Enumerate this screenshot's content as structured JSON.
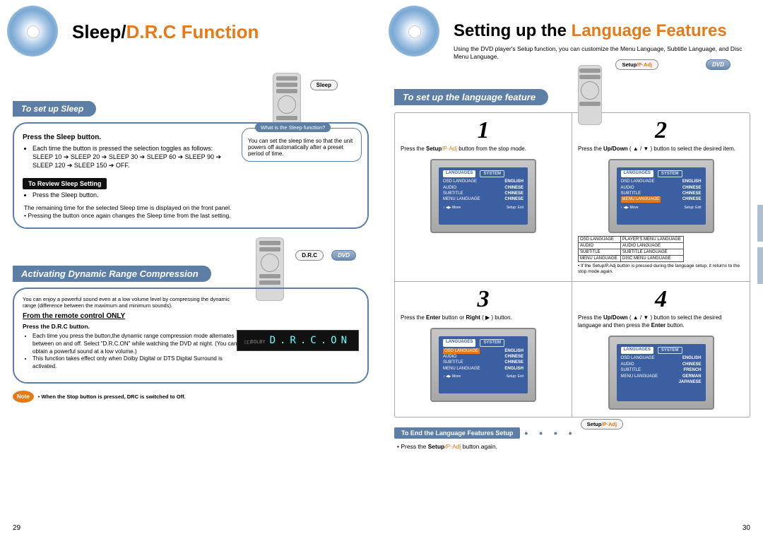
{
  "left": {
    "title_a": "Sleep/",
    "title_b": "D.R.C Function",
    "band_sleep": "To set up Sleep",
    "sleep_btn_label": "Sleep",
    "press_sleep": "Press the Sleep button.",
    "sleep_toggles1": "Each time the button is pressed the selection toggles as follows: SLEEP 10 ➔ SLEEP 20 ➔ SLEEP 30 ➔ SLEEP 60 ➔ SLEEP 90 ➔ SLEEP 120 ➔ SLEEP 150 ➔ OFF.",
    "review_bar": "To Review Sleep Setting",
    "review_1": "Press the Sleep button.",
    "review_2": "The remaining time for the selected Sleep time is displayed on the front panel.",
    "review_3": "Pressing the button once again changes the Sleep time from the last setting.",
    "callout_tab": "What is the Sleep function?",
    "callout_body": "You can set the sleep time so that the unit powers off automatically after a preset period of time.",
    "band_drc": "Activating Dynamic Range Compression",
    "drc_btn_label": "D.R.C",
    "dvd_label": "DVD",
    "drc_intro": "You can enjoy a powerful sound even at a low volume level by compressing the dynamic range (difference between the maximum and minimum sounds).",
    "drc_remote_only": "From the remote control ONLY",
    "press_drc": "Press the D.R.C button.",
    "drc_1": "Each time you press the button,the dynamic range compression mode alternates between on and off. Select \"D.R.C.ON\" while watching the DVD at night. (You can obtain a powerful sound at a low volume.)",
    "drc_2": "This function takes effect only when Dolby Digital or DTS Digital Surround is activated.",
    "lcd_text": "D.R.C.ON",
    "note_label": "Note",
    "note_text": "When the Stop button is pressed, DRC is switched to Off.",
    "page": "29"
  },
  "right": {
    "title_a": "Setting up the ",
    "title_b": "Language Features",
    "sub": "Using the DVD player's Setup function, you can customize the Menu Language, Subtitle Language, and Disc Menu Language.",
    "band": "To set up the language feature",
    "setup_btn": "Setup/P·Adj",
    "dvd_label": "DVD",
    "step1_num": "1",
    "step1": "Press the Setup/P·Adj button from the stop mode.",
    "step2_num": "2",
    "step2": "Press the Up/Down ( ▲ / ▼ )  button  to select the desired item.",
    "step2_foot": "If the Setup/P.Adj button is pressed during the language setup, it returns to the stop mode again.",
    "step3_num": "3",
    "step3": "Press the Enter button or Right ( ▶ ) button.",
    "step4_num": "4",
    "step4": "Press the Up/Down ( ▲ / ▼ ) button to select the desired language and then press the Enter button.",
    "tv_tab_lang": "LANGUAGES",
    "tv_tab_sys": "SYSTEM",
    "tv_rows": [
      {
        "k": "OSD LANGUAGE",
        "v": "ENGLISH"
      },
      {
        "k": "AUDIO",
        "v": "CHINESE"
      },
      {
        "k": "SUBTITLE",
        "v": "CHINESE"
      },
      {
        "k": "MENU LANGUAGE",
        "v": "CHINESE"
      }
    ],
    "tv3_rows": [
      {
        "k": "OSD LANGUAGE",
        "v": "ENGLISH"
      },
      {
        "k": "AUDIO",
        "v": "CHINESE"
      },
      {
        "k": "SUBTITLE",
        "v": "CHINESE"
      },
      {
        "k": "MENU LANGUAGE",
        "v": "ENGLISH"
      }
    ],
    "tv4_rows": [
      {
        "k": "OSD LANGUAGE",
        "v": "ENGLISH"
      },
      {
        "k": "AUDIO",
        "v": "CHINESE"
      },
      {
        "k": "SUBTITLE",
        "v": "FRENCH"
      },
      {
        "k": "MENU LANGUAGE",
        "v": "GERMAN"
      },
      {
        "k": "",
        "v": "JAPANESE"
      }
    ],
    "tvfoot_move": "Move",
    "tvfoot_exit": "Setup: Exit",
    "legend": [
      {
        "k": "OSD LANGUAGE",
        "v": "PLAYER'S MENU LANGUAGE"
      },
      {
        "k": "AUDIO",
        "v": "AUDIO LANGUAGE"
      },
      {
        "k": "SUBTITLE",
        "v": "SUBTITLE LANGUAGE"
      },
      {
        "k": "MENU LANGUAGE",
        "v": "DISC MENU LANGUAGE"
      }
    ],
    "end_bar": "To End the Language Features Setup",
    "end_btn": "Setup/P·Adj",
    "end_text": "Press the Setup/P·Adj button again.",
    "page": "30"
  }
}
